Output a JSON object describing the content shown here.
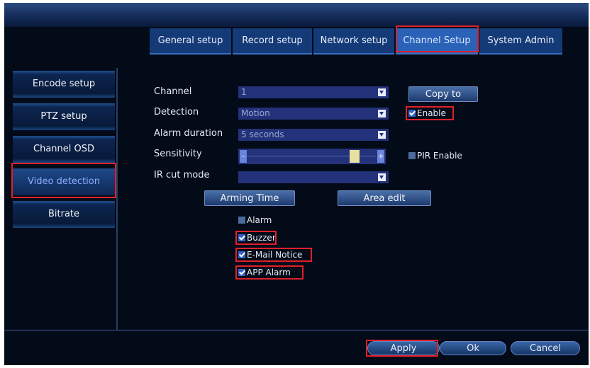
{
  "tabs": [
    {
      "label": "General setup"
    },
    {
      "label": "Record setup"
    },
    {
      "label": "Network setup"
    },
    {
      "label": "Channel Setup"
    },
    {
      "label": "System Admin"
    }
  ],
  "sidebar": {
    "items": [
      {
        "label": "Encode setup"
      },
      {
        "label": "PTZ setup"
      },
      {
        "label": "Channel OSD"
      },
      {
        "label": "Video detection"
      },
      {
        "label": "Bitrate"
      }
    ]
  },
  "form": {
    "channel_label": "Channel",
    "channel_value": "1",
    "detection_label": "Detection",
    "detection_value": "Motion",
    "alarm_duration_label": "Alarm duration",
    "alarm_duration_value": "5 seconds",
    "sensitivity_label": "Sensitivity",
    "sensitivity_minus": "-",
    "sensitivity_plus": "+",
    "sensitivity_level": 0.85,
    "ir_cut_label": "IR cut mode",
    "ir_cut_value": "",
    "copy_to": "Copy to",
    "enable_label": "Enable",
    "enable_checked": true,
    "pir_label": "PIR Enable",
    "pir_checked": false,
    "arming_time": "Arming Time",
    "area_edit": "Area edit"
  },
  "actions": [
    {
      "label": "Alarm",
      "checked": false
    },
    {
      "label": "Buzzer",
      "checked": true
    },
    {
      "label": "E-Mail Notice",
      "checked": true
    },
    {
      "label": "APP Alarm",
      "checked": true
    }
  ],
  "footer": {
    "apply": "Apply",
    "ok": "Ok",
    "cancel": "Cancel"
  },
  "colors": {
    "highlight": "#e0202a",
    "active_tab": "#2a62b8",
    "panel": "#030a18"
  }
}
